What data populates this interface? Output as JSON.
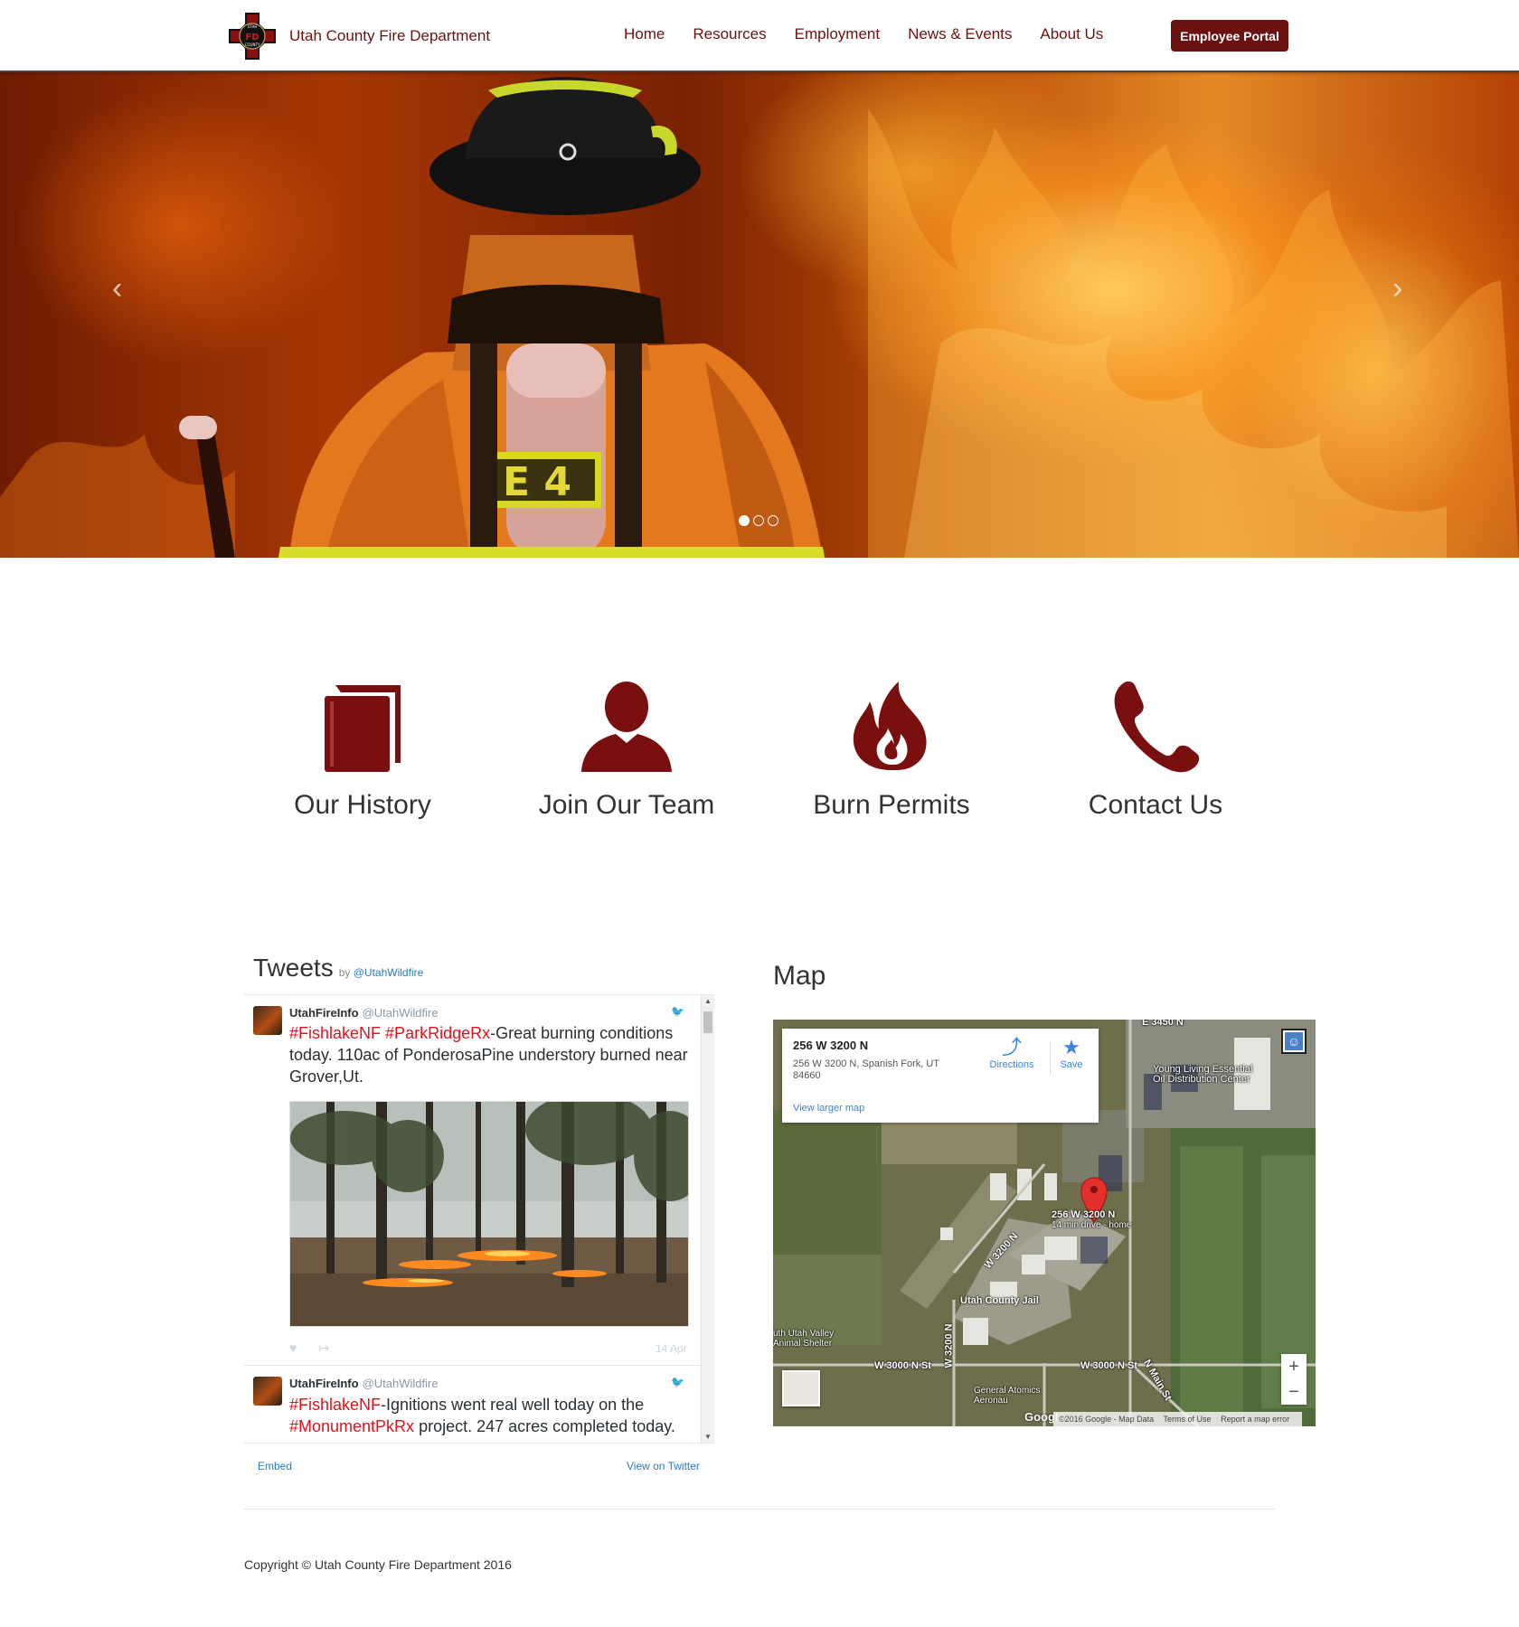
{
  "header": {
    "site_name": "Utah County Fire Department",
    "nav": [
      "Home",
      "Resources",
      "Employment",
      "News & Events",
      "About Us"
    ],
    "portal_label": "Employee Portal",
    "logo_text_top": "UTAH",
    "logo_text_mid": "FD",
    "logo_text_bottom": "COUNTY"
  },
  "hero": {
    "prev_icon": "‹",
    "next_icon": "›",
    "slide_count": 3,
    "active_slide": 1,
    "tank_label": "E 4"
  },
  "features": [
    {
      "label": "Our History",
      "icon": "book-icon"
    },
    {
      "label": "Join Our Team",
      "icon": "user-icon"
    },
    {
      "label": "Burn Permits",
      "icon": "fire-icon"
    },
    {
      "label": "Contact Us",
      "icon": "phone-icon"
    }
  ],
  "tweets": {
    "title": "Tweets",
    "by_prefix": "by",
    "by_handle": "@UtahWildfire",
    "items": [
      {
        "author": "UtahFireInfo",
        "handle": "@UtahWildfire",
        "hashtags": [
          "#FishlakeNF",
          "#ParkRidgeRx"
        ],
        "text": "-Great burning conditions today. 110ac of PonderosaPine understory burned near Grover,Ut.",
        "date": "14 Apr",
        "has_photo": true
      },
      {
        "author": "UtahFireInfo",
        "handle": "@UtahWildfire",
        "hashtag1": "#FishlakeNF",
        "text1": "-Ignitions went real well today on the ",
        "hashtag2": "#MonumentPkRx",
        "text2": " project. 247 acres completed today."
      }
    ],
    "embed_label": "Embed",
    "view_label": "View on Twitter"
  },
  "map": {
    "title": "Map",
    "card_title": "256 W 3200 N",
    "card_address": "256 W 3200 N, Spanish Fork, UT 84660",
    "larger_map": "View larger map",
    "directions": "Directions",
    "save": "Save",
    "labels": {
      "e3450n": "E 3450 N",
      "young_living": "Young Living Essential Oil Distribution Center",
      "pin_address": "256 W 3200 N",
      "pin_drive": "14 min drive - home",
      "w3200n": "W 3200 N",
      "jail": "Utah County Jail",
      "shelter": "uth Utah Valley Animal Shelter",
      "w3000n_st_left": "W 3000 N St",
      "w3000n_st_right": "W 3000 N St",
      "w3200n_vertical": "W 3200 N",
      "n_main_st": "N Main St",
      "general_atomics": "General Atomics Aeronau"
    },
    "zoom_in": "+",
    "zoom_out": "−",
    "google": "Google",
    "attribution": [
      "©2016 Google - Map Data",
      "Terms of Use",
      "Report a map error"
    ],
    "accent_color": "#3a84df"
  },
  "footer": {
    "copyright": "Copyright © Utah County Fire Department 2016"
  },
  "colors": {
    "brand": "#6b1111",
    "hashtag": "#e0141e",
    "link": "#2b7bb9"
  }
}
